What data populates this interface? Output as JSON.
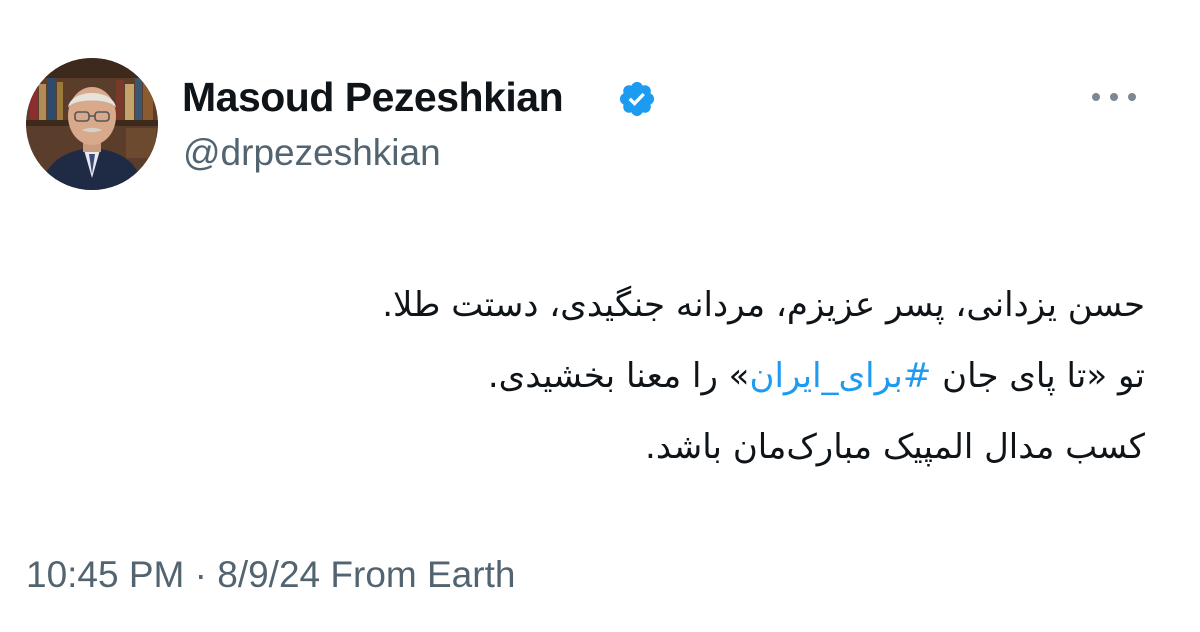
{
  "author": {
    "name": "Masoud Pezeshkian",
    "handle": "@drpezeshkian",
    "verified": true
  },
  "tweet": {
    "line1": "حسن یزدانی، پسر عزیزم، مردانه جنگیدی، دستت طلا.",
    "line2_before": "تو «تا پای جان ",
    "line2_hashtag": "#برای_ایران",
    "line2_after": "» را معنا بخشیدی.",
    "line3": "کسب مدال المپیک مبارک‌مان باشد."
  },
  "meta": {
    "text": "10:45 PM · 8/9/24 From Earth"
  },
  "icons": {
    "verified": "verified-badge-icon",
    "more": "more-options-icon"
  },
  "colors": {
    "accent": "#1d9bf0",
    "secondary_text": "#536471",
    "primary_text": "#0f1419"
  }
}
